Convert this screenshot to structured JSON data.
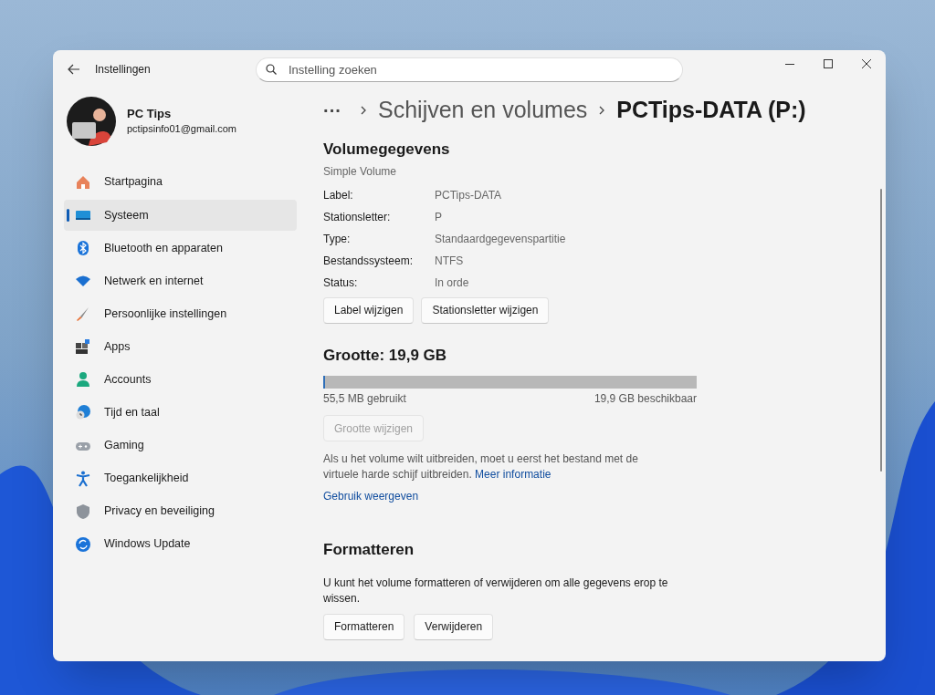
{
  "window": {
    "title": "Instellingen"
  },
  "search": {
    "placeholder": "Instelling zoeken"
  },
  "user": {
    "name": "PC Tips",
    "email": "pctipsinfo01@gmail.com"
  },
  "sidebar": {
    "items": [
      {
        "label": "Startpagina",
        "kind": "home",
        "selected": false
      },
      {
        "label": "Systeem",
        "kind": "system",
        "selected": true
      },
      {
        "label": "Bluetooth en apparaten",
        "kind": "bluetooth",
        "selected": false
      },
      {
        "label": "Netwerk en internet",
        "kind": "network",
        "selected": false
      },
      {
        "label": "Persoonlijke instellingen",
        "kind": "brush",
        "selected": false
      },
      {
        "label": "Apps",
        "kind": "apps",
        "selected": false
      },
      {
        "label": "Accounts",
        "kind": "person",
        "selected": false
      },
      {
        "label": "Tijd en taal",
        "kind": "clock",
        "selected": false
      },
      {
        "label": "Gaming",
        "kind": "gamepad",
        "selected": false
      },
      {
        "label": "Toegankelijkheid",
        "kind": "accessibility",
        "selected": false
      },
      {
        "label": "Privacy en beveiliging",
        "kind": "shield",
        "selected": false
      },
      {
        "label": "Windows Update",
        "kind": "update",
        "selected": false
      }
    ]
  },
  "breadcrumb": {
    "more": "···",
    "items": [
      "Schijven en volumes",
      "PCTips-DATA (P:)"
    ]
  },
  "volume": {
    "heading": "Volumegegevens",
    "subtitle": "Simple Volume",
    "properties": [
      {
        "label": "Label:",
        "value": "PCTips-DATA"
      },
      {
        "label": "Stationsletter:",
        "value": "P"
      },
      {
        "label": "Type:",
        "value": "Standaardgegevenspartitie"
      },
      {
        "label": "Bestandssysteem:",
        "value": "NTFS"
      },
      {
        "label": "Status:",
        "value": "In orde"
      }
    ],
    "buttons": [
      {
        "label": "Label wijzigen",
        "disabled": false
      },
      {
        "label": "Stationsletter wijzigen",
        "disabled": false
      }
    ]
  },
  "size": {
    "heading": "Grootte: 19,9 GB",
    "level": 0.003,
    "used": "55,5 MB gebruikt",
    "available": "19,9 GB beschikbaar",
    "button": {
      "label": "Grootte wijzigen",
      "disabled": true
    },
    "note": "Als u het volume wilt uitbreiden, moet u eerst het bestand met de virtuele harde schijf uitbreiden.",
    "note_link": "Meer informatie",
    "usage_link": "Gebruik weergeven"
  },
  "format": {
    "heading": "Formatteren",
    "text": "U kunt het volume formatteren of verwijderen om alle gegevens erop te wissen.",
    "buttons": [
      {
        "label": "Formatteren",
        "disabled": false
      },
      {
        "label": "Verwijderen",
        "disabled": false
      }
    ]
  }
}
